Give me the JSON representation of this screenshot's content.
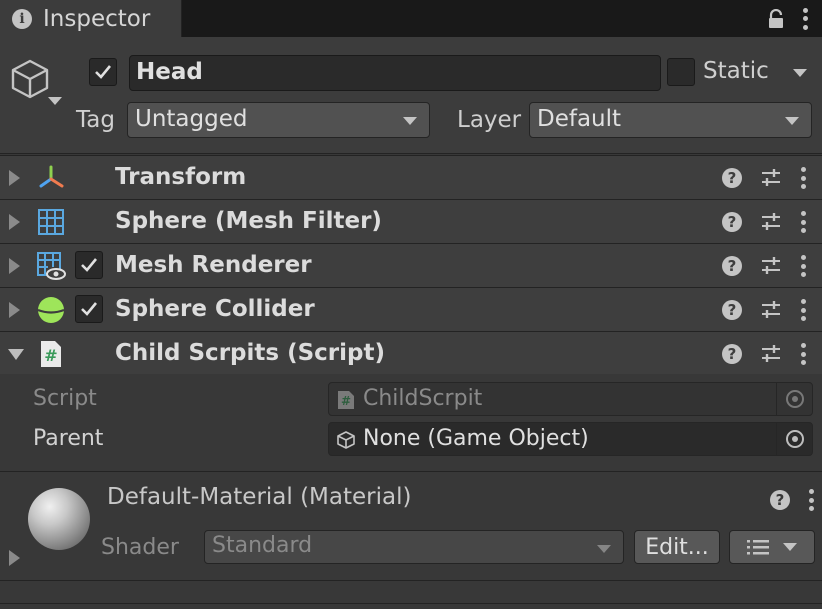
{
  "tab": {
    "title": "Inspector",
    "icon": "info-icon"
  },
  "header": {
    "object_name": "Head",
    "active": true,
    "static_label": "Static",
    "static_checked": false,
    "tag_label": "Tag",
    "tag_value": "Untagged",
    "layer_label": "Layer",
    "layer_value": "Default"
  },
  "components": [
    {
      "title": "Transform",
      "icon": "transform-icon",
      "has_checkbox": false,
      "expanded": false
    },
    {
      "title": "Sphere (Mesh Filter)",
      "icon": "mesh-filter-icon",
      "has_checkbox": false,
      "expanded": false
    },
    {
      "title": "Mesh Renderer",
      "icon": "mesh-renderer-icon",
      "has_checkbox": true,
      "checked": true,
      "expanded": false
    },
    {
      "title": "Sphere Collider",
      "icon": "sphere-collider-icon",
      "has_checkbox": true,
      "checked": true,
      "expanded": false
    },
    {
      "title": "Child Scrpits (Script)",
      "icon": "script-icon",
      "has_checkbox": false,
      "expanded": true
    }
  ],
  "script_fields": {
    "script_label": "Script",
    "script_value": "ChildScrpit",
    "parent_label": "Parent",
    "parent_value": "None (Game Object)"
  },
  "material": {
    "title": "Default-Material (Material)",
    "shader_label": "Shader",
    "shader_value": "Standard",
    "edit_label": "Edit..."
  },
  "colors": {
    "background": "#383838",
    "tabbar": "#191919",
    "text": "#d2d2d2",
    "collider_green": "#9ee55a",
    "script_green": "#3a9a5a",
    "mesh_blue": "#5aa8e0"
  }
}
